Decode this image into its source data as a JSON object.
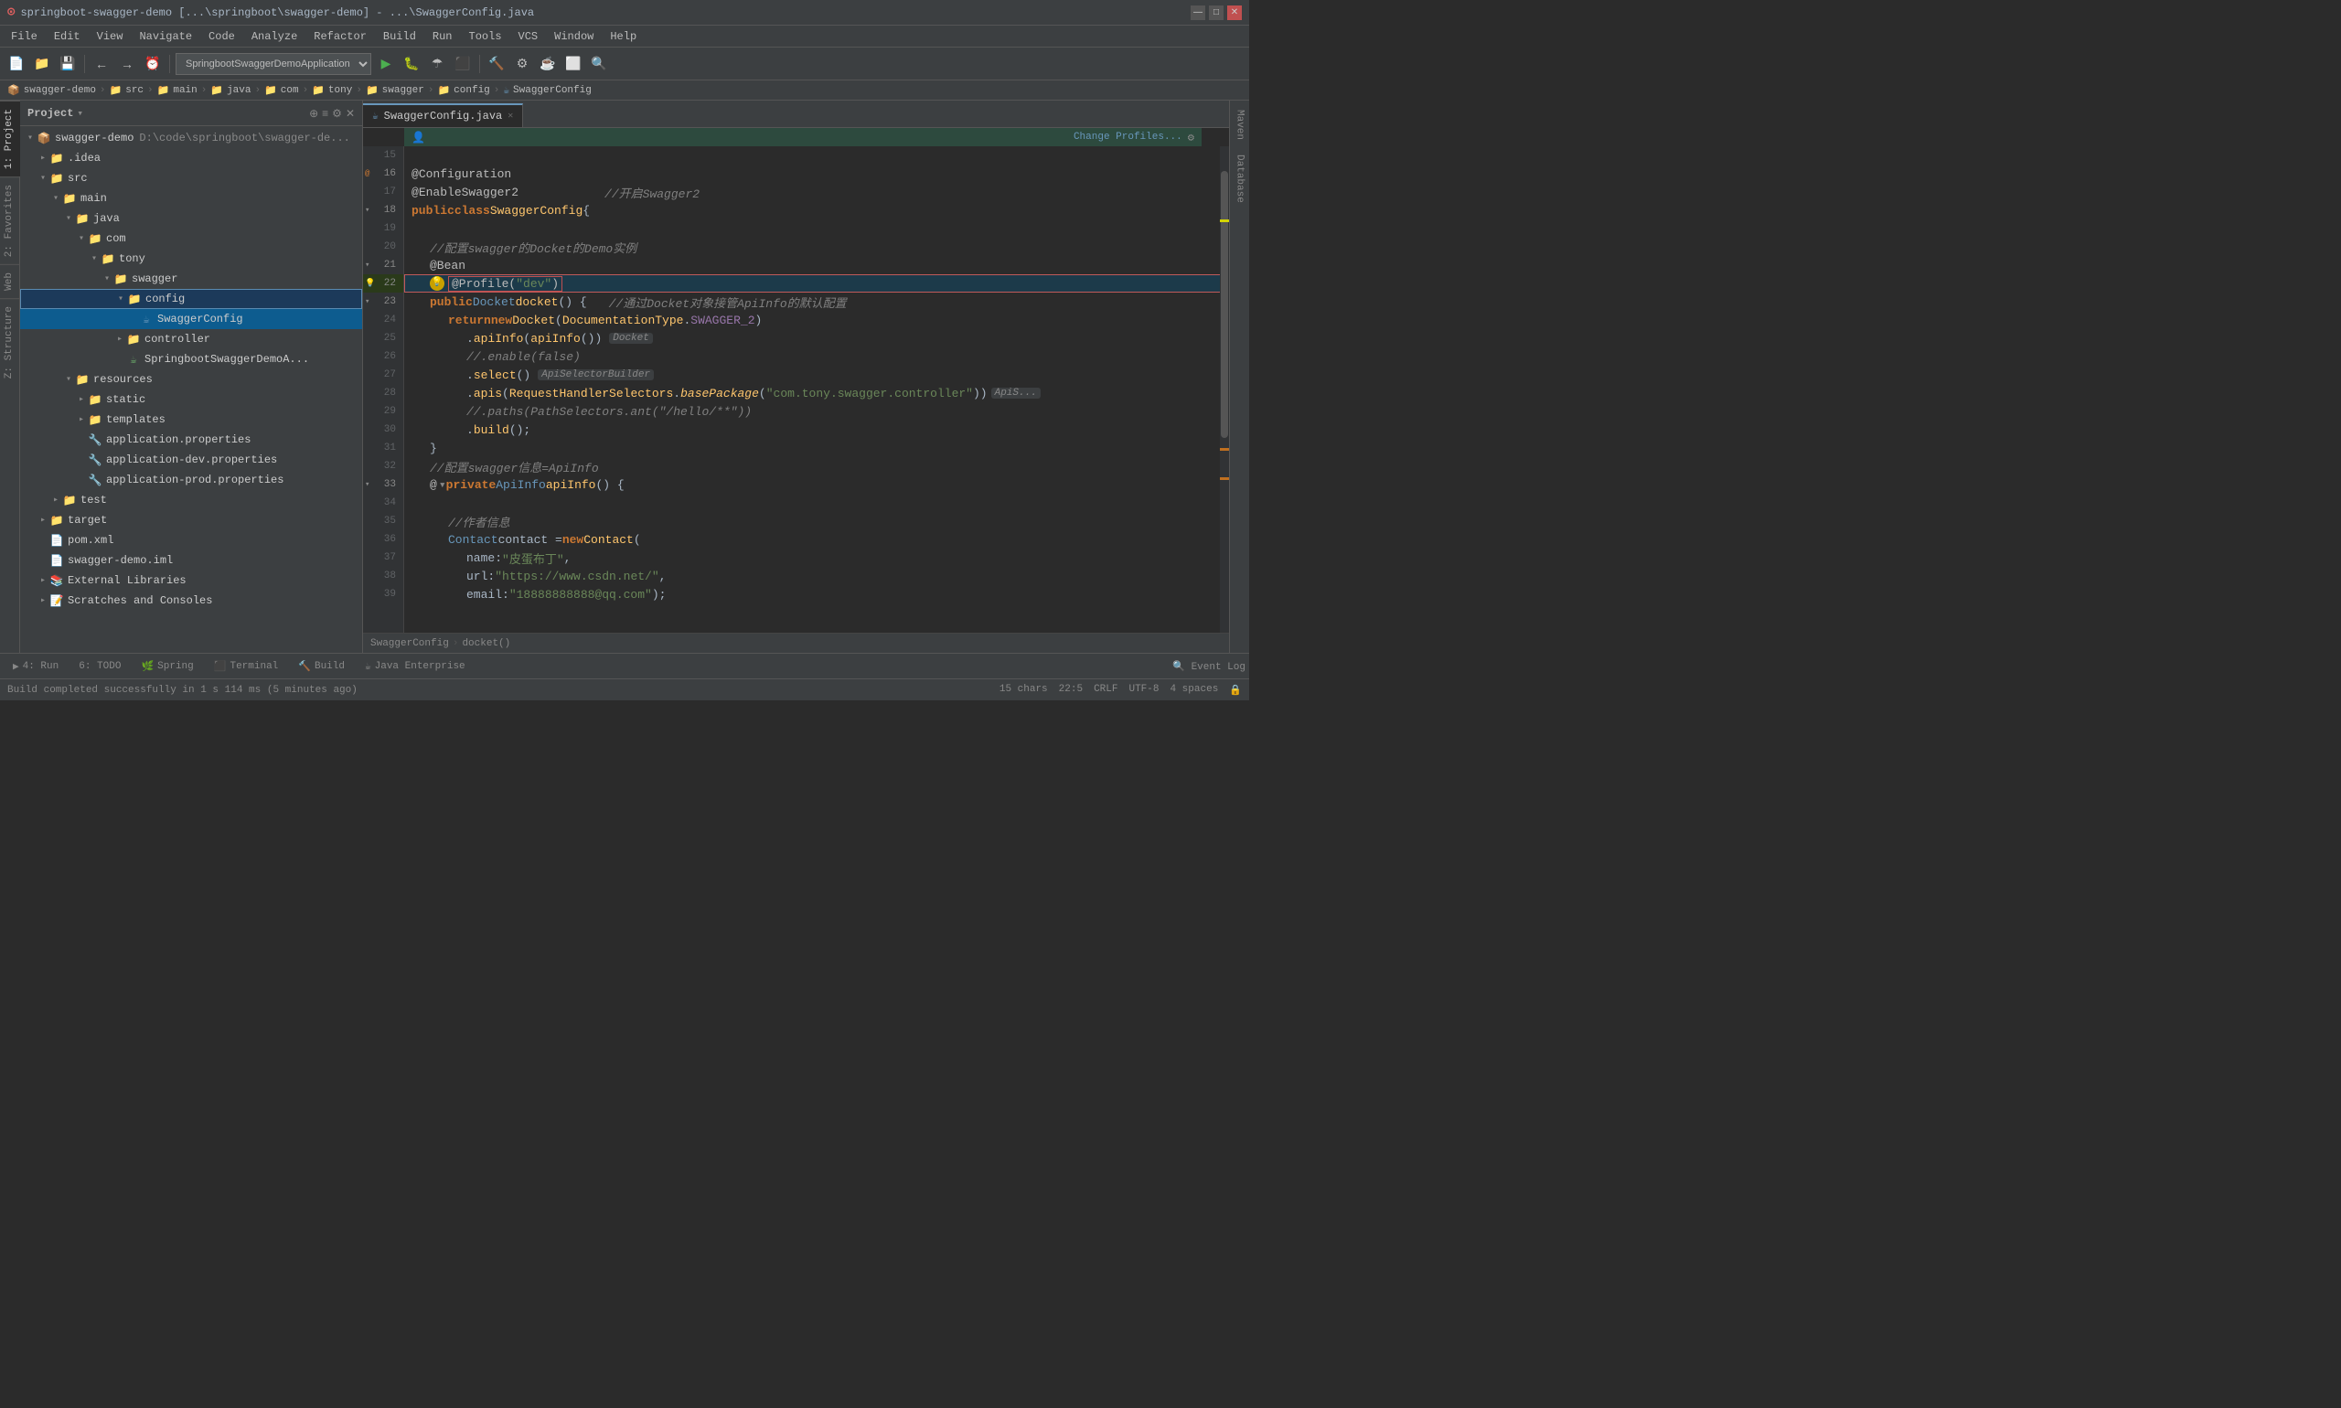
{
  "titleBar": {
    "title": "springboot-swagger-demo [...\\springboot\\swagger-demo] - ...\\SwaggerConfig.java",
    "minimize": "—",
    "maximize": "□",
    "close": "✕"
  },
  "menuBar": {
    "items": [
      "File",
      "Edit",
      "View",
      "Navigate",
      "Code",
      "Analyze",
      "Refactor",
      "Build",
      "Run",
      "Tools",
      "VCS",
      "Window",
      "Help"
    ]
  },
  "toolbar": {
    "runConfig": "SpringbootSwaggerDemoApplication",
    "changeProfiles": "Change Profiles..."
  },
  "breadcrumb": {
    "items": [
      "swagger-demo",
      "src",
      "main",
      "java",
      "com",
      "tony",
      "swagger",
      "config",
      "SwaggerConfig"
    ]
  },
  "sidebar": {
    "title": "Project",
    "projectRoot": "swagger-demo",
    "projectPath": "D:\\code\\springboot\\swagger-de...",
    "tree": [
      {
        "id": "swagger-demo",
        "label": "swagger-demo",
        "type": "project",
        "level": 0,
        "expanded": true,
        "path": "D:\\code\\springboot\\swagger-de..."
      },
      {
        "id": "idea",
        "label": ".idea",
        "type": "folder",
        "level": 1,
        "expanded": false
      },
      {
        "id": "src",
        "label": "src",
        "type": "folder",
        "level": 1,
        "expanded": true
      },
      {
        "id": "main",
        "label": "main",
        "type": "folder",
        "level": 2,
        "expanded": true
      },
      {
        "id": "java",
        "label": "java",
        "type": "folder",
        "level": 3,
        "expanded": true
      },
      {
        "id": "com",
        "label": "com",
        "type": "folder",
        "level": 4,
        "expanded": true
      },
      {
        "id": "tony",
        "label": "tony",
        "type": "folder",
        "level": 5,
        "expanded": true
      },
      {
        "id": "swagger",
        "label": "swagger",
        "type": "folder",
        "level": 6,
        "expanded": true
      },
      {
        "id": "config",
        "label": "config",
        "type": "folder",
        "level": 7,
        "expanded": true,
        "selected": true
      },
      {
        "id": "SwaggerConfig",
        "label": "SwaggerConfig",
        "type": "java",
        "level": 8,
        "selected": true
      },
      {
        "id": "controller",
        "label": "controller",
        "type": "folder",
        "level": 7,
        "expanded": false
      },
      {
        "id": "SpringbootSwaggerDemoA",
        "label": "SpringbootSwaggerDemoA...",
        "type": "java",
        "level": 7
      },
      {
        "id": "resources",
        "label": "resources",
        "type": "folder",
        "level": 3,
        "expanded": true
      },
      {
        "id": "static",
        "label": "static",
        "type": "folder",
        "level": 4,
        "expanded": false
      },
      {
        "id": "templates",
        "label": "templates",
        "type": "folder",
        "level": 4,
        "expanded": false
      },
      {
        "id": "application.properties",
        "label": "application.properties",
        "type": "properties",
        "level": 4
      },
      {
        "id": "application-dev.properties",
        "label": "application-dev.properties",
        "type": "properties",
        "level": 4
      },
      {
        "id": "application-prod.properties",
        "label": "application-prod.properties",
        "type": "properties",
        "level": 4
      },
      {
        "id": "test",
        "label": "test",
        "type": "folder",
        "level": 2,
        "expanded": false
      },
      {
        "id": "target",
        "label": "target",
        "type": "folder",
        "level": 1,
        "expanded": false
      },
      {
        "id": "pom.xml",
        "label": "pom.xml",
        "type": "xml",
        "level": 1
      },
      {
        "id": "swagger-demo.iml",
        "label": "swagger-demo.iml",
        "type": "iml",
        "level": 1
      },
      {
        "id": "External Libraries",
        "label": "External Libraries",
        "type": "ext",
        "level": 1,
        "expanded": false
      },
      {
        "id": "Scratches",
        "label": "Scratches and Consoles",
        "type": "scratch",
        "level": 1,
        "expanded": false
      }
    ]
  },
  "editor": {
    "filename": "SwaggerConfig.java",
    "lines": [
      {
        "num": 15,
        "content": ""
      },
      {
        "num": 16,
        "content": "@Configuration",
        "hasAnnotationFold": true
      },
      {
        "num": 17,
        "content": "@EnableSwagger2",
        "comment": "//开启Swagger2"
      },
      {
        "num": 18,
        "content": "public class SwaggerConfig {",
        "hasFold": true,
        "hasAnnotationFold": true
      },
      {
        "num": 19,
        "content": ""
      },
      {
        "num": 20,
        "content": "    //配置swagger的Docket的Demo实例"
      },
      {
        "num": 21,
        "content": "    @Bean",
        "hasFold": true
      },
      {
        "num": 22,
        "content": "    @Profile(\"dev\")",
        "highlighted": true,
        "hasHint": true
      },
      {
        "num": 23,
        "content": "    public Docket docket() {",
        "comment": "//通过Docket对象接管ApiInfo的默认配置",
        "hasFold": true
      },
      {
        "num": 24,
        "content": "        return new Docket(DocumentationType.SWAGGER_2)"
      },
      {
        "num": 25,
        "content": "                .apiInfo(apiInfo())",
        "inlineHint": "Docket"
      },
      {
        "num": 26,
        "content": "                //.enable(false)"
      },
      {
        "num": 27,
        "content": "                .select()",
        "inlineHint": "ApiSelectorBuilder"
      },
      {
        "num": 28,
        "content": "                .apis(RequestHandlerSelectors.basePackage(\"com.tony.swagger.controller\"))",
        "inlineHint": "ApiS..."
      },
      {
        "num": 29,
        "content": "                //.paths(PathSelectors.ant(\"/hello/**\"))"
      },
      {
        "num": 30,
        "content": "                .build();"
      },
      {
        "num": 31,
        "content": "    }"
      },
      {
        "num": 32,
        "content": "    //配置swagger信息=ApiInfo"
      },
      {
        "num": 33,
        "content": "    private ApiInfo apiInfo() {",
        "hasFold": true,
        "hasAnnotationFold": true
      },
      {
        "num": 34,
        "content": ""
      },
      {
        "num": 35,
        "content": "        //作者信息"
      },
      {
        "num": 36,
        "content": "        Contact contact = new Contact("
      },
      {
        "num": 37,
        "content": "                name: \"皮蛋布丁\","
      },
      {
        "num": 38,
        "content": "                url: \"https://www.csdn.net/\","
      },
      {
        "num": 39,
        "content": "                email: \"18888888888@qq.com\");"
      }
    ]
  },
  "editorBreadcrumb": {
    "items": [
      "SwaggerConfig",
      "docket()"
    ]
  },
  "bottomTabs": [
    {
      "label": "4: Run",
      "icon": "▶"
    },
    {
      "label": "6: TODO",
      "icon": ""
    },
    {
      "label": "Spring",
      "icon": "🌿"
    },
    {
      "label": "Terminal",
      "icon": "⬛"
    },
    {
      "label": "Build",
      "icon": "🔨"
    },
    {
      "label": "Java Enterprise",
      "icon": "☕"
    }
  ],
  "statusBar": {
    "buildStatus": "Build completed successfully in 1 s 114 ms (5 minutes ago)",
    "chars": "15 chars",
    "position": "22:5",
    "lineEnding": "CRLF",
    "encoding": "UTF-8",
    "indent": "4 spaces",
    "eventLog": "Event Log"
  },
  "leftTabs": [
    {
      "label": "1: Project"
    },
    {
      "label": "2: Favorites"
    },
    {
      "label": "Web"
    },
    {
      "label": "Z: Structure"
    }
  ],
  "rightTabs": [
    {
      "label": "Maven"
    },
    {
      "label": "Database"
    }
  ]
}
